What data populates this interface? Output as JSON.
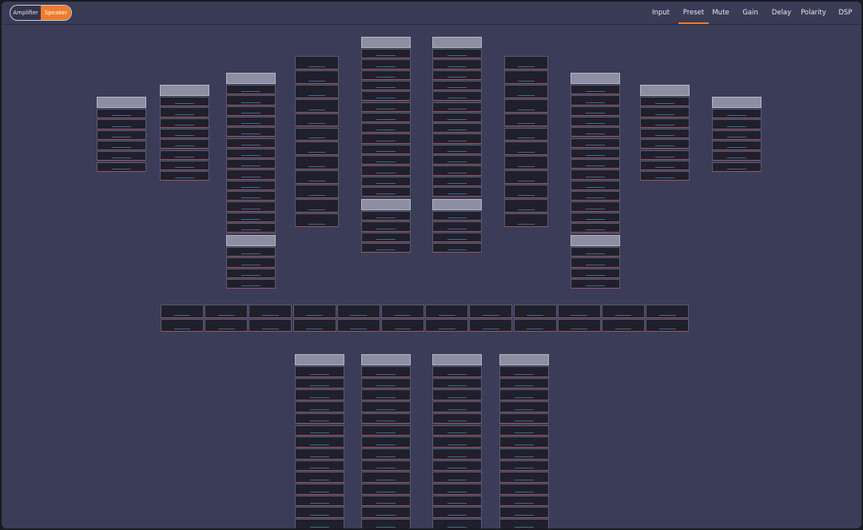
{
  "toggle": {
    "amplifier": "Amplifier",
    "speaker": "Speaker",
    "selected": "Speaker"
  },
  "nav": {
    "items": [
      "Input",
      "Preset",
      "Mute",
      "Gain",
      "Delay",
      "Polarity",
      "DSP"
    ],
    "active": "Preset"
  },
  "colors": {
    "accent": "#ef7b2e",
    "background": "#3b3c57",
    "cell": "#1f202b",
    "header": "#8d8ea1"
  }
}
